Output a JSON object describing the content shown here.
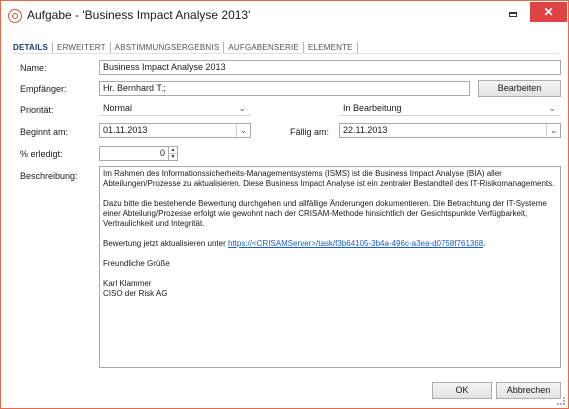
{
  "window": {
    "title": "Aufgabe - 'Business Impact Analyse 2013'",
    "close_label": "✕",
    "accent": "#e04343"
  },
  "tabs": [
    {
      "label": "DETAILS"
    },
    {
      "label": "ERWEITERT"
    },
    {
      "label": "ABSTIMMUNGSERGEBNIS"
    },
    {
      "label": "AUFGABENSERIE"
    },
    {
      "label": "ELEMENTE"
    }
  ],
  "form": {
    "name_label": "Name:",
    "name_value": "Business Impact Analyse 2013",
    "recipient_label": "Empfänger:",
    "recipient_value": "Hr. Bernhard T.;",
    "edit_button": "Bearbeiten",
    "priority_label": "Priorität:",
    "priority_value": "Normal",
    "status_value": "In Bearbeitung",
    "start_label": "Beginnt am:",
    "start_value": "01.11.2013",
    "due_label": "Fällig am:",
    "due_value": "22.11.2013",
    "done_label": "% erledigt:",
    "done_value": "0",
    "description_label": "Beschreibung:"
  },
  "description": {
    "p1": "Im Rahmen des Informationssicherheits-Managementsystems (ISMS) ist die Business Impact Analyse (BIA) aller Abteilungen/Prozesse zu aktualisieren. Diese Business Impact Analyse ist ein zentraler Bestandteil des IT-Risikomanagements.",
    "p2": "Dazu bitte die bestehende Bewertung durchgehen und allfällige Änderungen dokumentieren. Die Betrachtung der IT-Systeme einer Abteilung/Prozesse erfolgt wie gewohnt nach der CRISAM-Methode hinsichtlich der Gesichtspunkte Verfügbarkeit, Vertraulichkeit und Integrität.",
    "p3_prefix": "Bewertung jetzt aktualisieren unter ",
    "p3_link": "https://<CRISAMServer>/task/f3b64105-3b4a-496c-a3ea-d0758f761368",
    "p3_suffix": ".",
    "greeting": "Freundliche Grüße",
    "sender_name": "Karl Klammer",
    "sender_title": "CISO der Risk AG"
  },
  "footer": {
    "ok_label": "OK",
    "cancel_label": "Abbrechen"
  }
}
